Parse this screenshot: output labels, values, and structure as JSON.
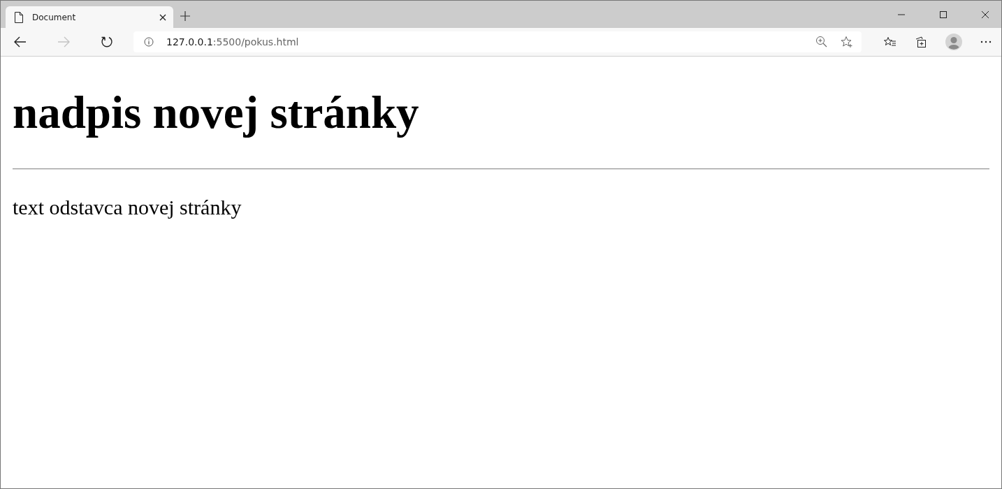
{
  "tab": {
    "title": "Document",
    "selected": true
  },
  "nav": [
    {
      "kind": "back",
      "disabled": false
    },
    {
      "kind": "forward",
      "disabled": true
    },
    {
      "kind": "reload",
      "disabled": false
    }
  ],
  "address": {
    "host": "127.0.0.1",
    "rest": ":5500/pokus.html"
  },
  "page": {
    "heading": "nadpis novej stránky",
    "paragraph": "text odstavca novej stránky"
  }
}
